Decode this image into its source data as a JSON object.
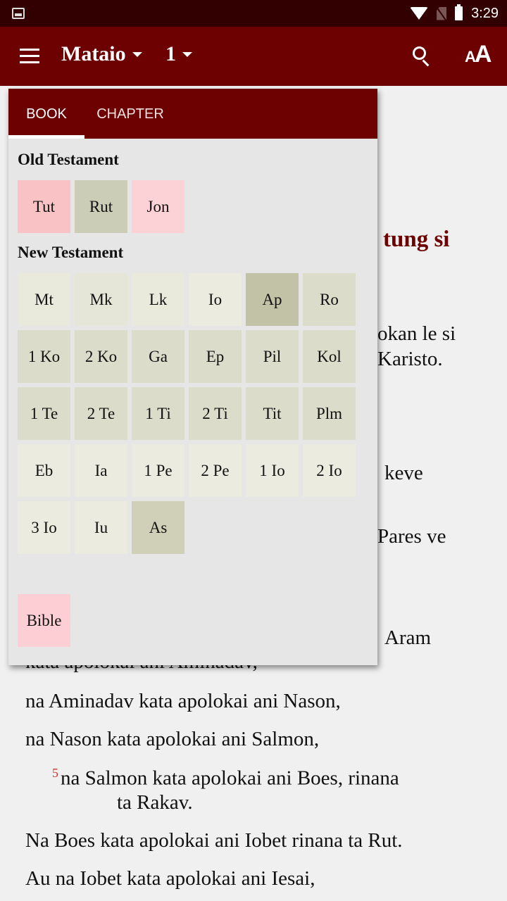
{
  "status_bar": {
    "time": "3:29",
    "icons": [
      "image-icon",
      "wifi-icon",
      "no-sim-icon",
      "battery-icon"
    ]
  },
  "app_bar": {
    "book": "Mataio",
    "chapter": "1",
    "icons": [
      "menu-icon",
      "search-icon",
      "text-size-icon"
    ],
    "text_size_small": "A",
    "text_size_big": "A"
  },
  "colors": {
    "primary": "#6d0000",
    "status_bar": "#330002",
    "verse_number": "#d32f2f",
    "ot_pink_1": "#f9c3c6",
    "ot_olive": "#cccdb6",
    "ot_pink_2": "#fdd2d6",
    "nt_light": "#e9e9dc",
    "nt_mid": "#dcdccb",
    "nt_dark": "#c2c2a6"
  },
  "popup": {
    "tabs": [
      {
        "label": "BOOK",
        "active": true
      },
      {
        "label": "CHAPTER",
        "active": false
      }
    ],
    "old_testament": {
      "title": "Old Testament",
      "books": [
        {
          "label": "Tut",
          "color": "#f9c3c6"
        },
        {
          "label": "Rut",
          "color": "#cccdb6"
        },
        {
          "label": "Jon",
          "color": "#fdd2d6"
        }
      ]
    },
    "new_testament": {
      "title": "New Testament",
      "books": [
        {
          "label": "Mt",
          "color": "#e9e9dc"
        },
        {
          "label": "Mk",
          "color": "#e6e6d8"
        },
        {
          "label": "Lk",
          "color": "#e9e9dc"
        },
        {
          "label": "Io",
          "color": "#ebebdf"
        },
        {
          "label": "Ap",
          "color": "#c2c2a6"
        },
        {
          "label": "Ro",
          "color": "#dcdccb"
        },
        {
          "label": "1 Ko",
          "color": "#dcdccb"
        },
        {
          "label": "2 Ko",
          "color": "#dcdccb"
        },
        {
          "label": "Ga",
          "color": "#dcdccb"
        },
        {
          "label": "Ep",
          "color": "#dcdccb"
        },
        {
          "label": "Pil",
          "color": "#dcdccb"
        },
        {
          "label": "Kol",
          "color": "#dcdccb"
        },
        {
          "label": "1 Te",
          "color": "#dcdccb"
        },
        {
          "label": "2 Te",
          "color": "#dcdccb"
        },
        {
          "label": "1 Ti",
          "color": "#dcdccb"
        },
        {
          "label": "2 Ti",
          "color": "#dcdccb"
        },
        {
          "label": "Tit",
          "color": "#dcdccb"
        },
        {
          "label": "Plm",
          "color": "#dcdccb"
        },
        {
          "label": "Eb",
          "color": "#ebebe0"
        },
        {
          "label": "Ia",
          "color": "#ebebe0"
        },
        {
          "label": "1 Pe",
          "color": "#ebebe0"
        },
        {
          "label": "2 Pe",
          "color": "#ebebe0"
        },
        {
          "label": "1 Io",
          "color": "#ebebe0"
        },
        {
          "label": "2 Io",
          "color": "#ebebe0"
        },
        {
          "label": "3 Io",
          "color": "#ebebe0"
        },
        {
          "label": "Iu",
          "color": "#ebebe0"
        },
        {
          "label": "As",
          "color": "#d0d0b8"
        }
      ]
    },
    "other": {
      "books": [
        {
          "label": "Bible",
          "color": "#fdcfd4"
        }
      ]
    }
  },
  "reader": {
    "heading_fragment": "tung si",
    "fragments": [
      "okan le si",
      "Karisto.",
      "keve",
      "Pares ve",
      "Aram",
      "kata apolokai ani Aminadav,"
    ],
    "lines": [
      "na Aminadav kata apolokai ani Nason,",
      "na Nason kata apolokai ani Salmon,"
    ],
    "verse5": {
      "number": "5",
      "text": "na Salmon kata apolokai ani Boes, rinana",
      "continuation": "ta Rakav."
    },
    "lines_after": [
      "Na Boes kata apolokai ani Iobet rinana ta Rut.",
      "Au na Iobet kata apolokai ani Iesai,"
    ]
  }
}
